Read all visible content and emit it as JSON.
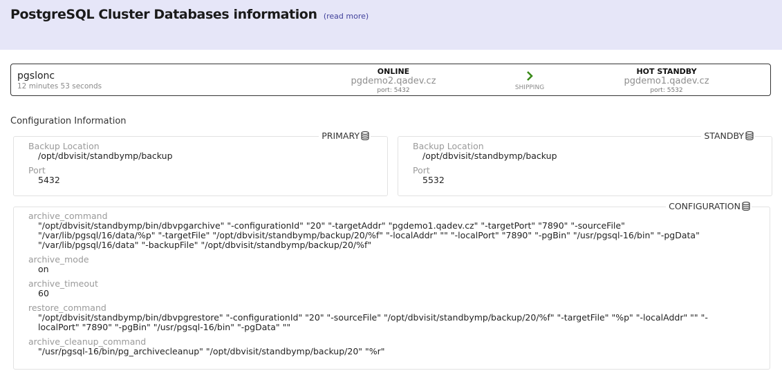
{
  "header": {
    "title": "PostgreSQL Cluster Databases information",
    "read_more": "(read more)"
  },
  "cluster": {
    "name": "pgslonc",
    "uptime": "12 minutes 53 seconds",
    "primary": {
      "status": "ONLINE",
      "host": "pgdemo2.qadev.cz",
      "port": "port: 5432"
    },
    "shipping": {
      "label": "SHIPPING",
      "icon": "chevron-right-icon",
      "color": "#3a8a1a"
    },
    "standby": {
      "status": "HOT STANDBY",
      "host": "pgdemo1.qadev.cz",
      "port": "port: 5532"
    }
  },
  "config": {
    "section_title": "Configuration Information",
    "primary": {
      "legend": "PRIMARY",
      "backup_location_label": "Backup Location",
      "backup_location": "/opt/dbvisit/standbymp/backup",
      "port_label": "Port",
      "port": "5432"
    },
    "standby": {
      "legend": "STANDBY",
      "backup_location_label": "Backup Location",
      "backup_location": "/opt/dbvisit/standbymp/backup",
      "port_label": "Port",
      "port": "5532"
    },
    "configuration": {
      "legend": "CONFIGURATION",
      "fields": [
        {
          "label": "archive_command",
          "value": "\"/opt/dbvisit/standbymp/bin/dbvpgarchive\" \"-configurationId\" \"20\" \"-targetAddr\" \"pgdemo1.qadev.cz\" \"-targetPort\" \"7890\" \"-sourceFile\" \"/var/lib/pgsql/16/data/%p\" \"-targetFile\" \"/opt/dbvisit/standbymp/backup/20/%f\" \"-localAddr\" \"\" \"-localPort\" \"7890\" \"-pgBin\" \"/usr/pgsql-16/bin\" \"-pgData\" \"/var/lib/pgsql/16/data\" \"-backupFile\" \"/opt/dbvisit/standbymp/backup/20/%f\""
        },
        {
          "label": "archive_mode",
          "value": "on"
        },
        {
          "label": "archive_timeout",
          "value": "60"
        },
        {
          "label": "restore_command",
          "value": "\"/opt/dbvisit/standbymp/bin/dbvpgrestore\" \"-configurationId\" \"20\" \"-sourceFile\" \"/opt/dbvisit/standbymp/backup/20/%f\" \"-targetFile\" \"%p\" \"-localAddr\" \"\" \"-localPort\" \"7890\" \"-pgBin\" \"/usr/pgsql-16/bin\" \"-pgData\" \"\""
        },
        {
          "label": "archive_cleanup_command",
          "value": "\"/usr/pgsql-16/bin/pg_archivecleanup\" \"/opt/dbvisit/standbymp/backup/20\" \"%r\""
        }
      ]
    },
    "legend_icon": "database-icon"
  }
}
